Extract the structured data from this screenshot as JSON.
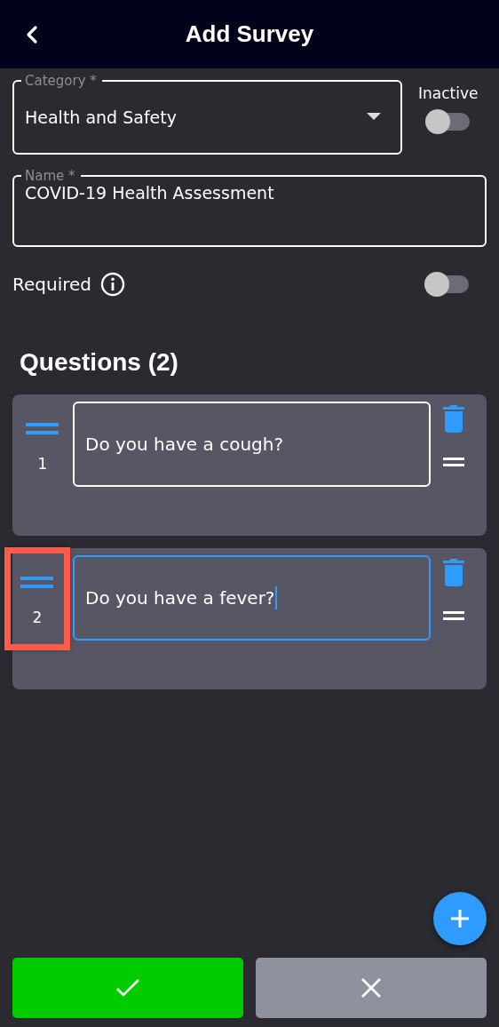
{
  "header": {
    "title": "Add Survey"
  },
  "category": {
    "label": "Category *",
    "value": "Health and Safety"
  },
  "inactive": {
    "label": "Inactive",
    "on": false
  },
  "name": {
    "label": "Name *",
    "value": "COVID-19 Health Assessment"
  },
  "required": {
    "label": "Required",
    "on": false
  },
  "questions_title": "Questions (2)",
  "questions": [
    {
      "number": "1",
      "text": "Do you have a cough?",
      "focused": false,
      "highlighted": false
    },
    {
      "number": "2",
      "text": "Do you have a fever?",
      "focused": true,
      "highlighted": true
    }
  ]
}
